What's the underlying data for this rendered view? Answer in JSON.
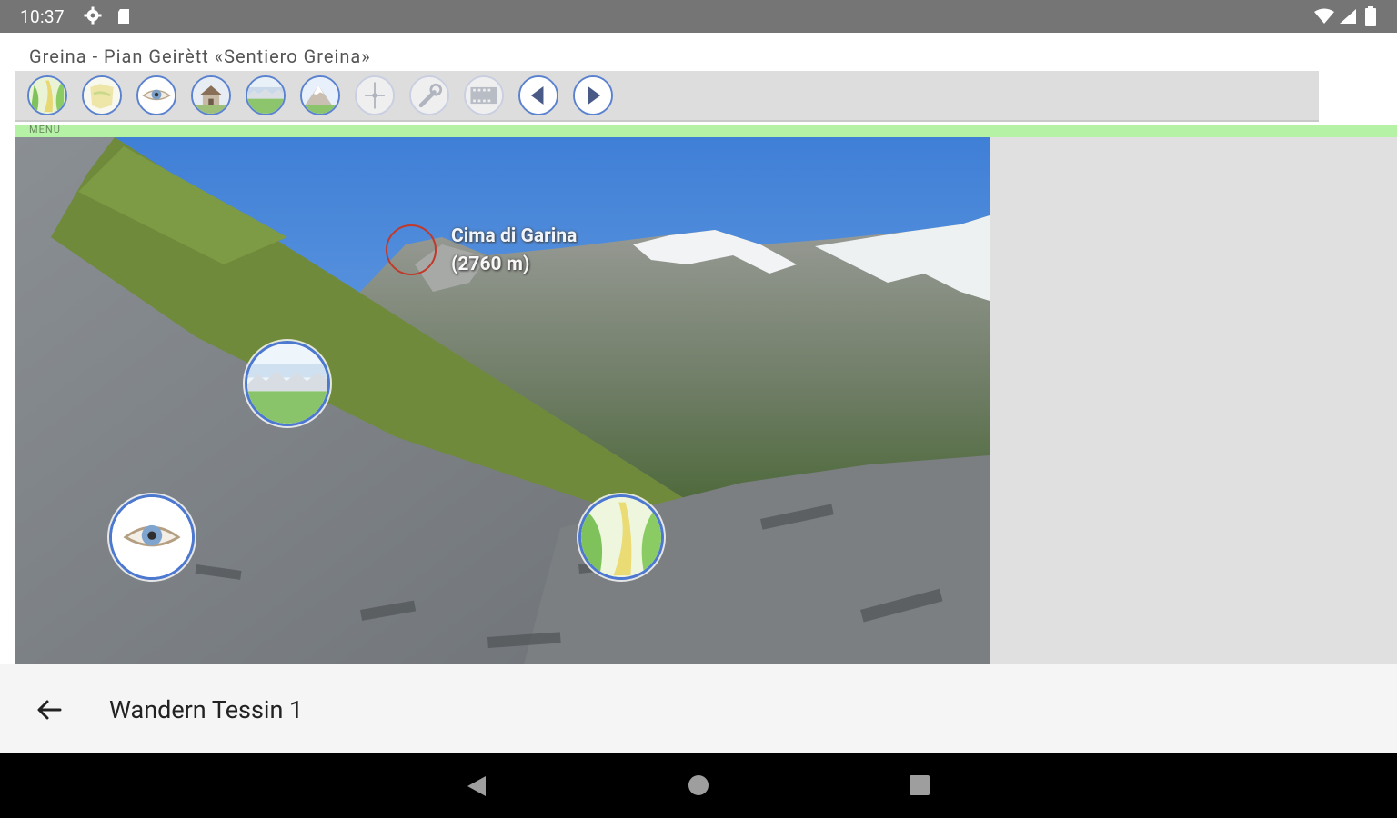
{
  "status_bar": {
    "time": "10:37"
  },
  "subtitle": "Greina - Pian Geirètt «Sentiero Greina»",
  "toolbar": {
    "buttons": [
      {
        "name": "route-map-button",
        "icon": "route-icon",
        "enabled": true
      },
      {
        "name": "map-button",
        "icon": "map-icon",
        "enabled": true
      },
      {
        "name": "view-button",
        "icon": "eye-icon",
        "enabled": true
      },
      {
        "name": "hut-button",
        "icon": "house-icon",
        "enabled": true
      },
      {
        "name": "panorama-button",
        "icon": "panorama-icon",
        "enabled": true
      },
      {
        "name": "mountain-button",
        "icon": "mountain-icon",
        "enabled": true
      },
      {
        "name": "compass-button",
        "icon": "compass-icon",
        "enabled": false
      },
      {
        "name": "tools-button",
        "icon": "wrench-icon",
        "enabled": false
      },
      {
        "name": "film-button",
        "icon": "film-icon",
        "enabled": false
      },
      {
        "name": "previous-button",
        "icon": "arrow-left-icon",
        "enabled": true
      },
      {
        "name": "next-button",
        "icon": "arrow-right-icon",
        "enabled": true
      }
    ]
  },
  "menu_label": "MENU",
  "photo": {
    "peak_label_name": "Cima di Garina",
    "peak_label_alt": "(2760 m)",
    "hotspots": [
      {
        "name": "panorama-hotspot",
        "icon": "panorama-icon"
      },
      {
        "name": "view-hotspot",
        "icon": "eye-icon"
      },
      {
        "name": "route-hotspot",
        "icon": "route-icon"
      }
    ]
  },
  "app_bar": {
    "title": "Wandern Tessin 1"
  },
  "colors": {
    "accent": "#4d78d0",
    "menu_strip": "#b5f2a6",
    "status_bar": "#757575"
  }
}
